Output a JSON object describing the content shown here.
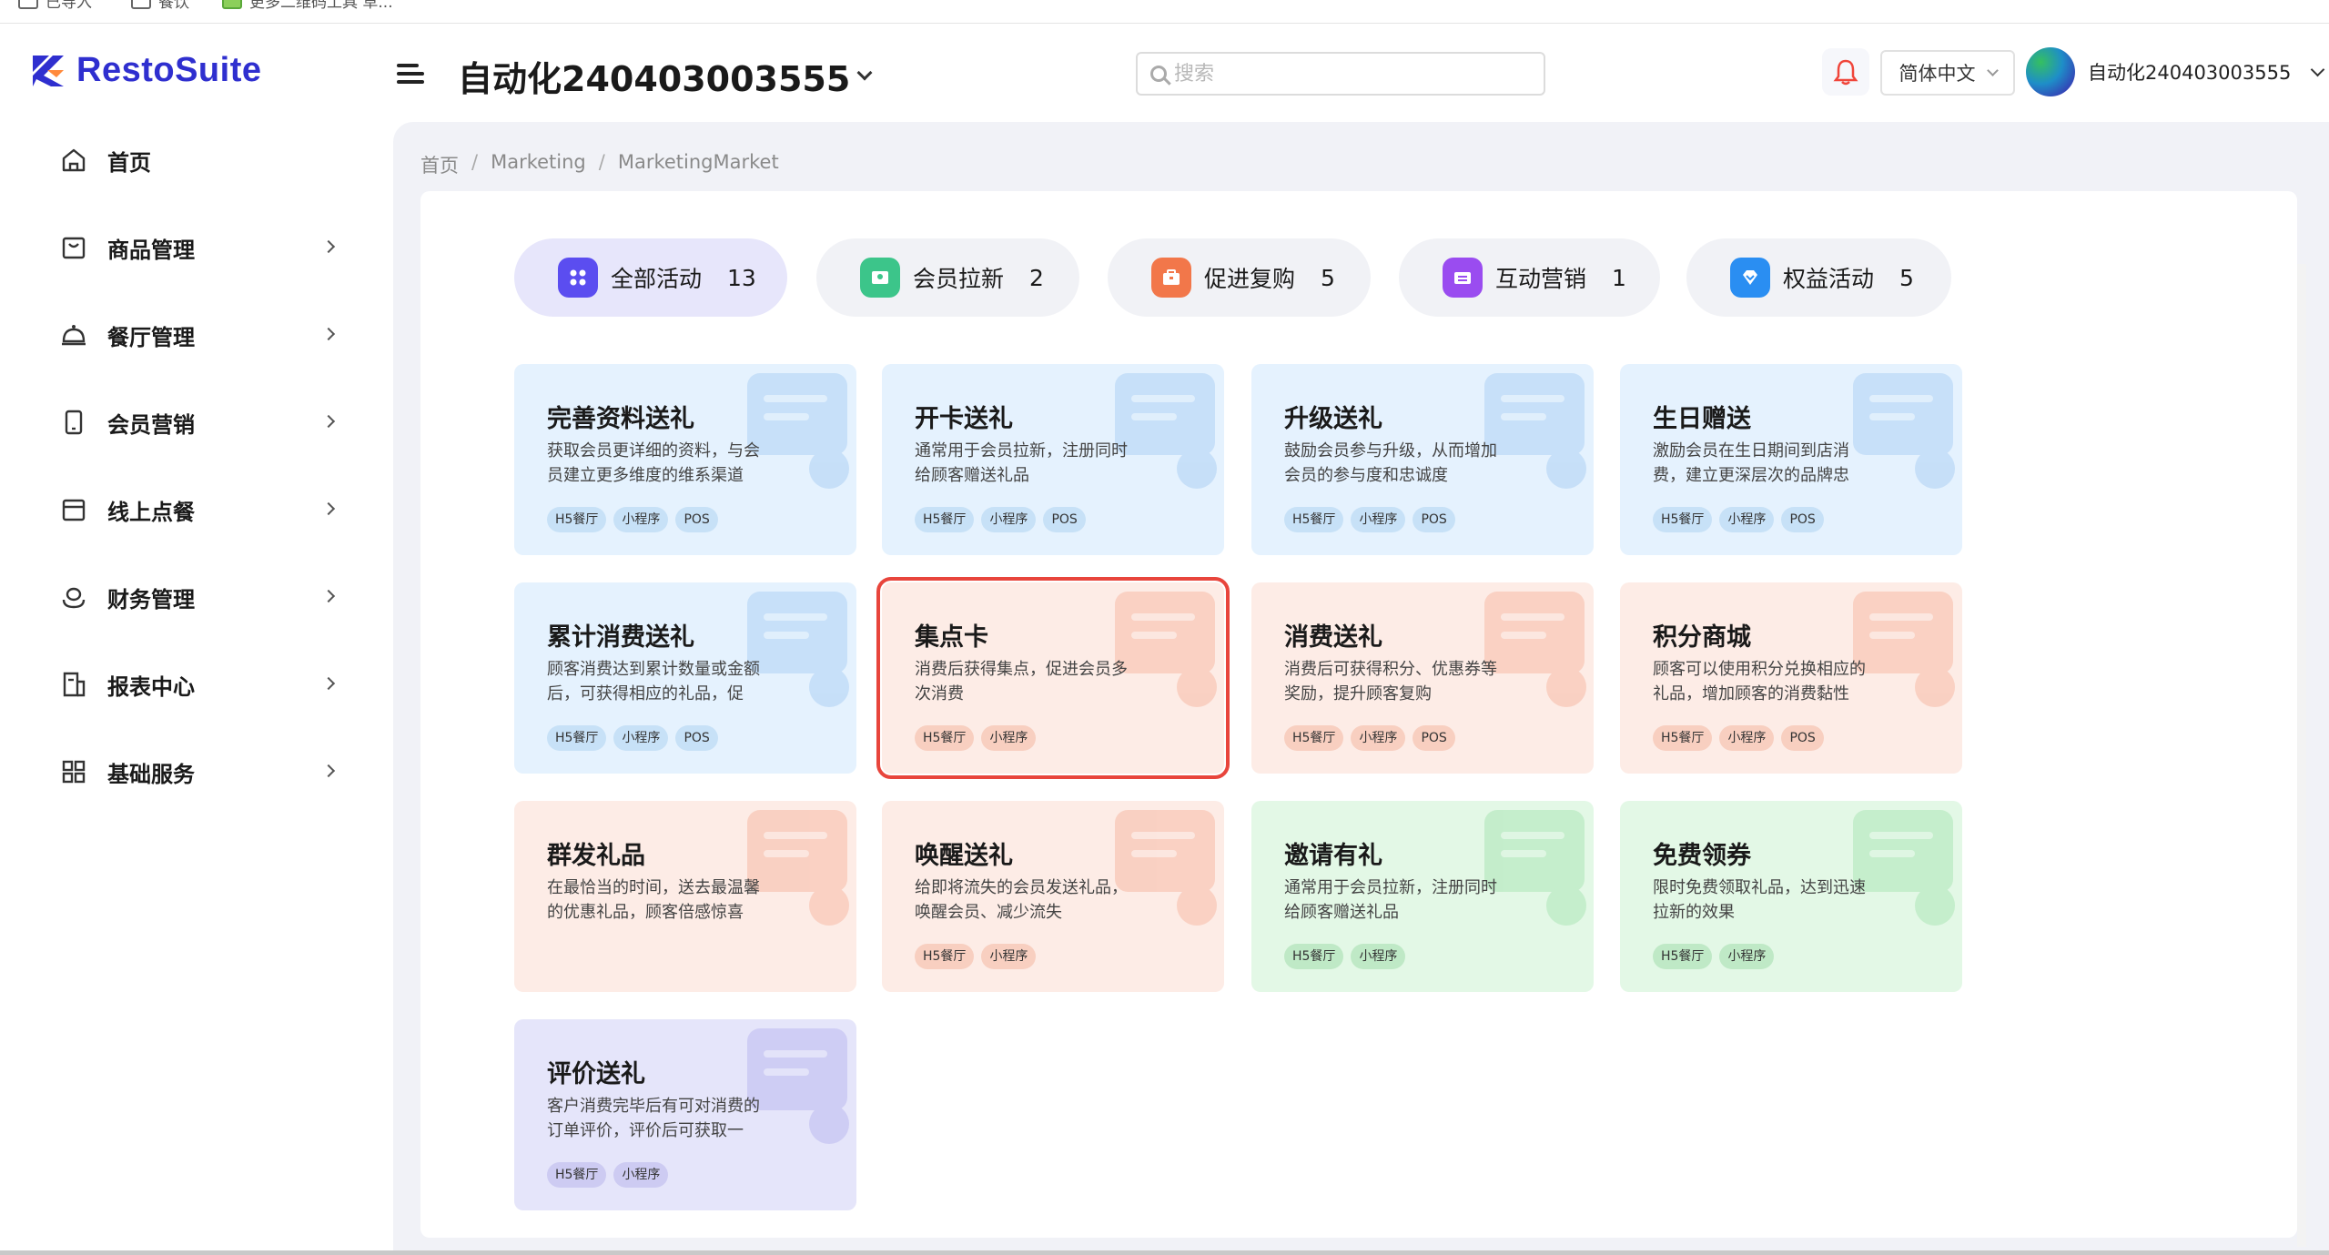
{
  "browser": {
    "bookmarks": [
      {
        "label": "已导入",
        "icon": "folder-icon"
      },
      {
        "label": "餐饮",
        "icon": "folder-icon"
      },
      {
        "label": "更多二维码工具 草...",
        "icon": "qr-icon"
      }
    ]
  },
  "header": {
    "logo_text": "RestoSuite",
    "store_name": "自动化240403003555",
    "search_placeholder": "搜索",
    "language": "简体中文",
    "user_name": "自动化240403003555"
  },
  "sidebar": {
    "items": [
      {
        "label": "首页",
        "icon": "home-icon",
        "has_arrow": false
      },
      {
        "label": "商品管理",
        "icon": "bag-icon",
        "has_arrow": true
      },
      {
        "label": "餐厅管理",
        "icon": "cloche-icon",
        "has_arrow": true
      },
      {
        "label": "会员营销",
        "icon": "phone-icon",
        "has_arrow": true
      },
      {
        "label": "线上点餐",
        "icon": "tray-icon",
        "has_arrow": true
      },
      {
        "label": "财务管理",
        "icon": "coins-icon",
        "has_arrow": true
      },
      {
        "label": "报表中心",
        "icon": "report-icon",
        "has_arrow": true
      },
      {
        "label": "基础服务",
        "icon": "grid-icon",
        "has_arrow": true
      }
    ]
  },
  "breadcrumb": [
    "首页",
    "Marketing",
    "MarketingMarket"
  ],
  "tabs": [
    {
      "label": "全部活动",
      "count": "13",
      "icon": "apps-icon",
      "color": "#5b4df0",
      "active": true
    },
    {
      "label": "会员拉新",
      "count": "2",
      "icon": "member-card-icon",
      "color": "#3cc58a",
      "active": false
    },
    {
      "label": "促进复购",
      "count": "5",
      "icon": "briefcase-icon",
      "color": "#f2774a",
      "active": false
    },
    {
      "label": "互动营销",
      "count": "1",
      "icon": "ticket-icon",
      "color": "#9a4cf0",
      "active": false
    },
    {
      "label": "权益活动",
      "count": "5",
      "icon": "diamond-icon",
      "color": "#2a8ef2",
      "active": false
    }
  ],
  "cards": [
    {
      "title": "完善资料送礼",
      "desc": "获取会员更详细的资料，与会员建立更多维度的维系渠道",
      "tags": [
        "H5餐厅",
        "小程序",
        "POS"
      ],
      "theme": "blue",
      "icon": "form-edit-icon"
    },
    {
      "title": "开卡送礼",
      "desc": "通常用于会员拉新，注册同时给顾客赠送礼品",
      "tags": [
        "H5餐厅",
        "小程序",
        "POS"
      ],
      "theme": "blue",
      "icon": "card-icon"
    },
    {
      "title": "升级送礼",
      "desc": "鼓励会员参与升级，从而增加会员的参与度和忠诚度",
      "tags": [
        "H5餐厅",
        "小程序",
        "POS"
      ],
      "theme": "blue",
      "icon": "rocket-icon"
    },
    {
      "title": "生日赠送",
      "desc": "激励会员在生日期间到店消费，建立更深层次的品牌忠诚...",
      "tags": [
        "H5餐厅",
        "小程序",
        "POS"
      ],
      "theme": "blue",
      "icon": "cake-icon"
    },
    {
      "title": "累计消费送礼",
      "desc": "顾客消费达到累计数量或金额后，可获得相应的礼品，促进...",
      "tags": [
        "H5餐厅",
        "小程序",
        "POS"
      ],
      "theme": "blue",
      "icon": "gift-coins-icon"
    },
    {
      "title": "集点卡",
      "desc": "消费后获得集点，促进会员多次消费",
      "tags": [
        "H5餐厅",
        "小程序"
      ],
      "theme": "peach",
      "icon": "stamp-card-icon",
      "selected": true
    },
    {
      "title": "消费送礼",
      "desc": "消费后可获得积分、优惠券等奖励，提升顾客复购",
      "tags": [
        "H5餐厅",
        "小程序",
        "POS"
      ],
      "theme": "peach",
      "icon": "gift-icon"
    },
    {
      "title": "积分商城",
      "desc": "顾客可以使用积分兑换相应的礼品，增加顾客的消费黏性",
      "tags": [
        "H5餐厅",
        "小程序",
        "POS"
      ],
      "theme": "peach",
      "icon": "shop-coins-icon"
    },
    {
      "title": "群发礼品",
      "desc": "在最恰当的时间，送去最温馨的优惠礼品，顾客倍感惊喜",
      "tags": [],
      "theme": "peach",
      "icon": "envelope-icon"
    },
    {
      "title": "唤醒送礼",
      "desc": "给即将流失的会员发送礼品，唤醒会员、减少流失",
      "tags": [
        "H5餐厅",
        "小程序"
      ],
      "theme": "peach",
      "icon": "heart-bubble-icon"
    },
    {
      "title": "邀请有礼",
      "desc": "通常用于会员拉新，注册同时给顾客赠送礼品",
      "tags": [
        "H5餐厅",
        "小程序"
      ],
      "theme": "green",
      "icon": "heart-mail-icon"
    },
    {
      "title": "免费领券",
      "desc": "限时免费领取礼品，达到迅速拉新的效果",
      "tags": [
        "H5餐厅",
        "小程序"
      ],
      "theme": "green",
      "icon": "gift-hand-icon"
    },
    {
      "title": "评价送礼",
      "desc": "客户消费完毕后有可对消费的订单评价，评价后可获取一定...",
      "tags": [
        "H5餐厅",
        "小程序"
      ],
      "theme": "purple",
      "icon": "chat-icon"
    }
  ]
}
